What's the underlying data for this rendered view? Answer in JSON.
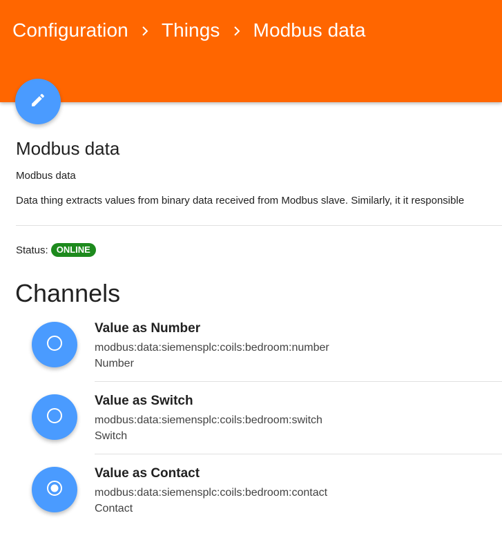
{
  "header": {
    "breadcrumb": [
      {
        "label": "Configuration"
      },
      {
        "label": "Things"
      },
      {
        "label": "Modbus data"
      }
    ],
    "color": "#ff6600"
  },
  "fab": {
    "icon": "pencil-icon",
    "color": "#4a9bff"
  },
  "thing": {
    "title": "Modbus data",
    "label": "Modbus data",
    "description": "Data thing extracts values from binary data received from Modbus slave. Similarly, it it responsible",
    "status_label": "Status:",
    "status": "ONLINE",
    "status_color": "#1d8a1d"
  },
  "channels": {
    "title": "Channels",
    "items": [
      {
        "name": "Value as Number",
        "uid": "modbus:data:siemensplc:coils:bedroom:number",
        "type": "Number",
        "icon": "radio-unchecked-icon"
      },
      {
        "name": "Value as Switch",
        "uid": "modbus:data:siemensplc:coils:bedroom:switch",
        "type": "Switch",
        "icon": "radio-unchecked-icon"
      },
      {
        "name": "Value as Contact",
        "uid": "modbus:data:siemensplc:coils:bedroom:contact",
        "type": "Contact",
        "icon": "radio-checked-icon"
      }
    ]
  }
}
